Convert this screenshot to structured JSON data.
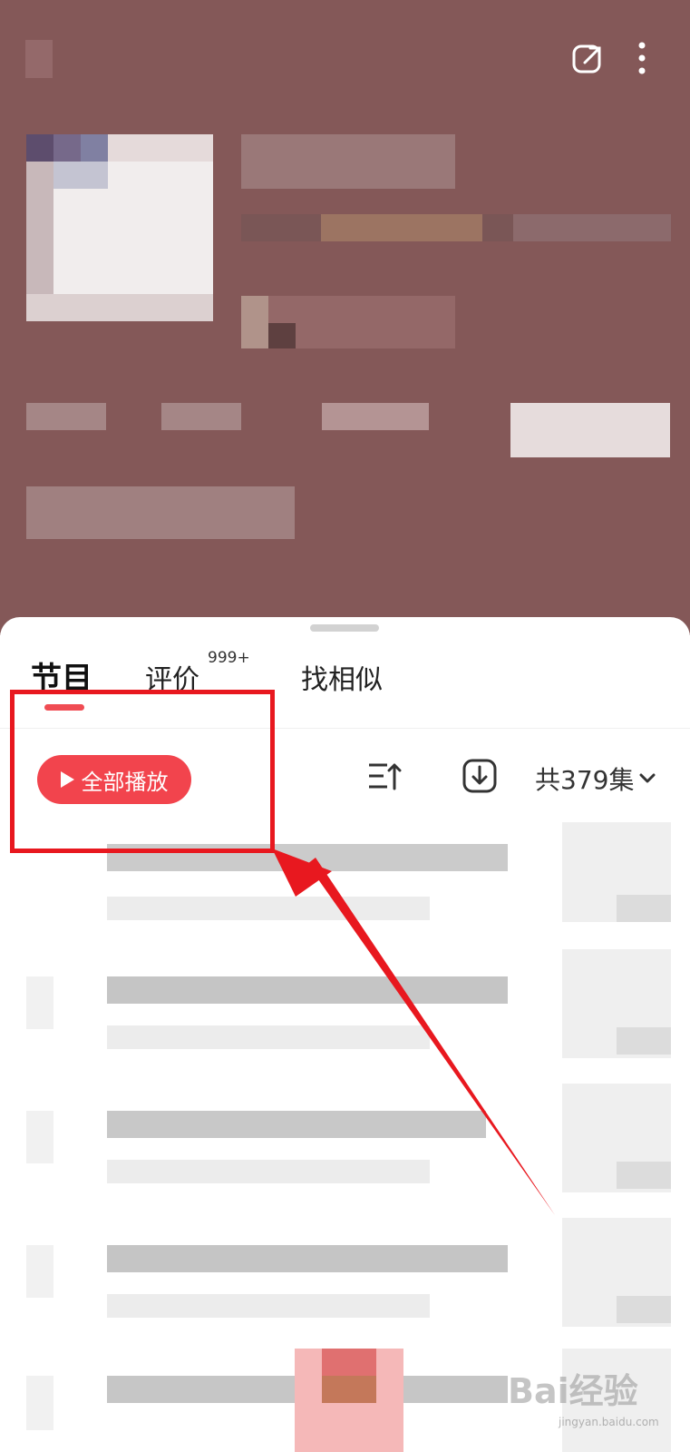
{
  "tabs": [
    {
      "label": "节目"
    },
    {
      "label": "评价",
      "badge": "999+"
    },
    {
      "label": "找相似"
    }
  ],
  "toolbar": {
    "play_all_label": "全部播放",
    "episode_count_label": "共379集"
  },
  "icons": {
    "share": "share-icon",
    "more": "more-vertical-icon",
    "sort": "sort-icon",
    "download": "download-icon",
    "expand": "chevron-down-icon"
  },
  "watermark": {
    "brand": "Bai经验",
    "site": "jingyan.baidu.com"
  },
  "colors": {
    "header_bg": "#845858",
    "accent": "#f2444d",
    "annotation": "#e8181f"
  }
}
